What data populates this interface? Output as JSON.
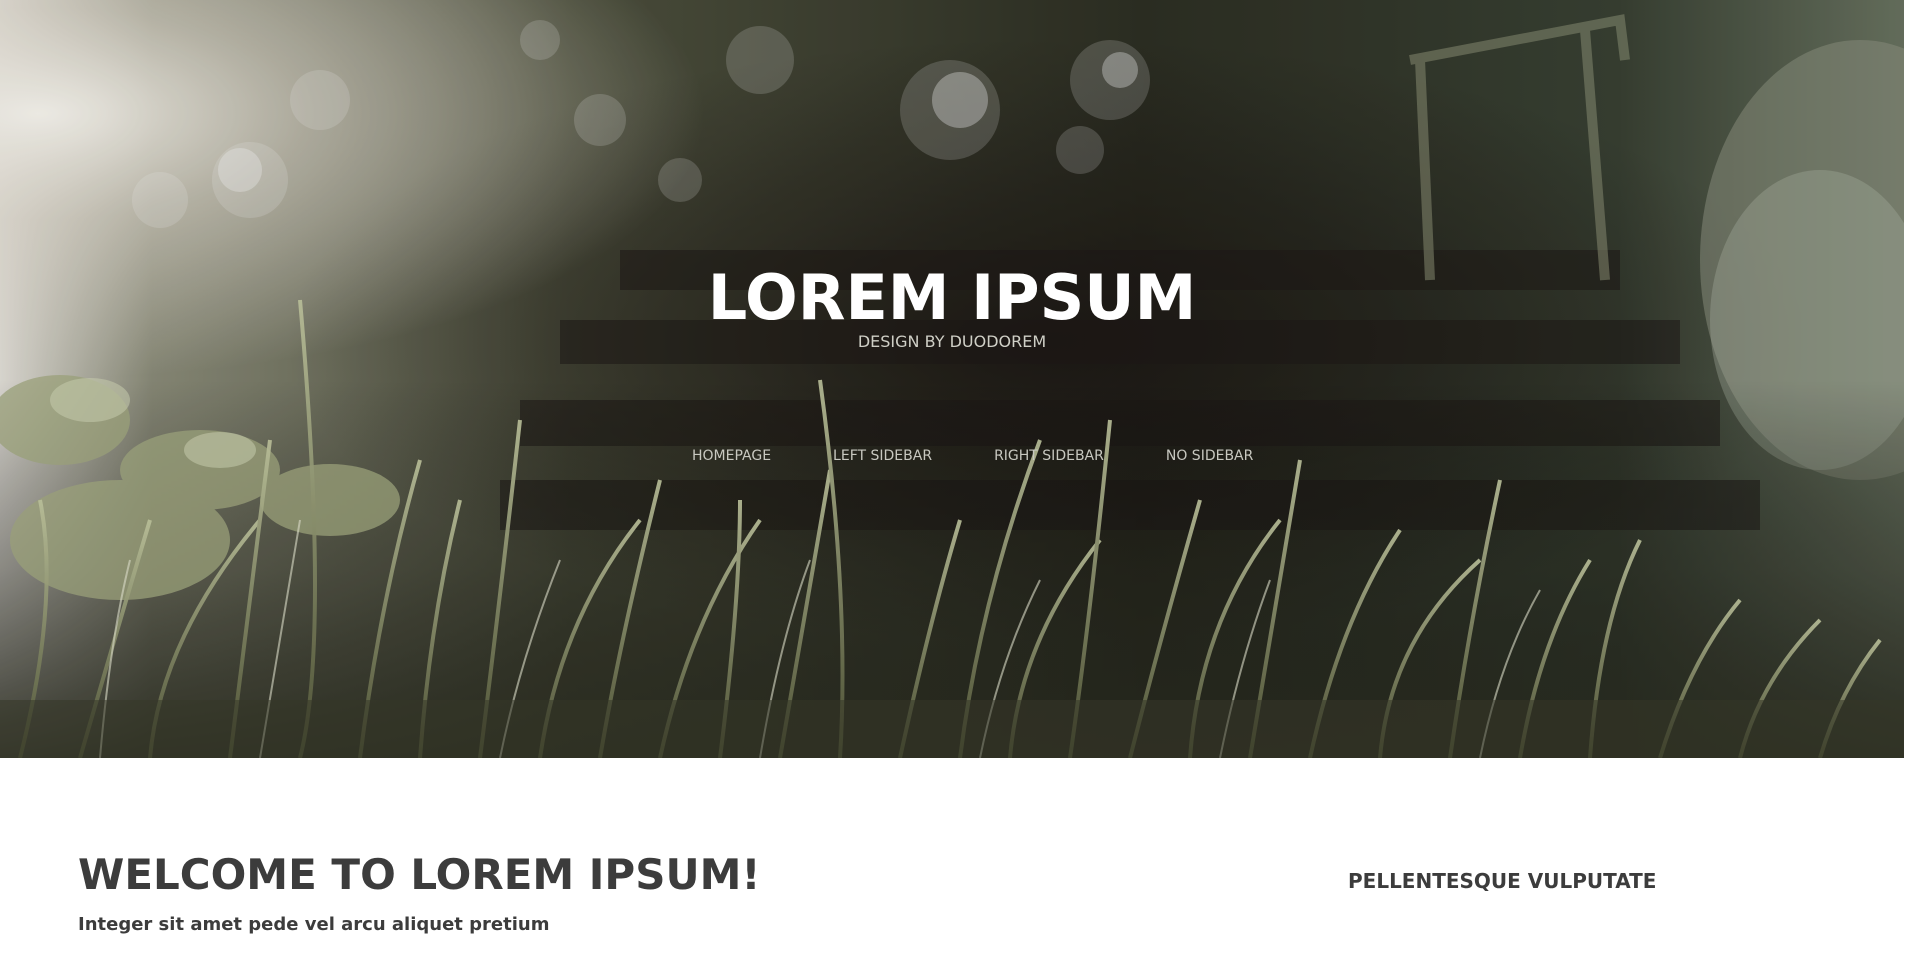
{
  "header": {
    "title": "LOREM IPSUM",
    "tagline": "DESIGN BY DUODOREM"
  },
  "nav": {
    "items": [
      {
        "label": "HOMEPAGE"
      },
      {
        "label": "LEFT SIDEBAR"
      },
      {
        "label": "RIGHT SIDEBAR"
      },
      {
        "label": "NO SIDEBAR"
      }
    ]
  },
  "main": {
    "heading": "WELCOME TO LOREM IPSUM!",
    "subheading": "Integer sit amet pede vel arcu aliquet pretium"
  },
  "sidebar": {
    "heading": "PELLENTESQUE VULPUTATE"
  },
  "colors": {
    "heading_text": "#3c3c3c",
    "hero_title": "#ffffff",
    "nav_text": "#c8c8c0",
    "page_background": "#ffffff"
  }
}
